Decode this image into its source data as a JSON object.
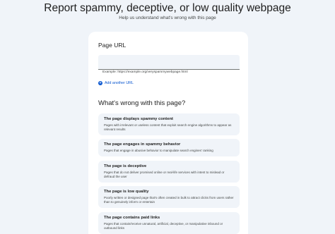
{
  "header": {
    "title": "Report spammy, deceptive, or low quality webpage",
    "subtitle": "Help us understand what's wrong with this page"
  },
  "url_section": {
    "label": "Page URL",
    "input_value": "",
    "helper": "Example: https://example.org/veryspammywebpage.html",
    "add_link": "Add another URL"
  },
  "question": {
    "heading": "What's wrong with this page?",
    "options": [
      {
        "title": "The page displays spammy content",
        "description": "Pages with irrelevant or useless content that exploit search engine algorithms to appear as relevant results"
      },
      {
        "title": "The page engages in spammy behavior",
        "description": "Pages that engage in abusive behavior to manipulate search engines' ranking"
      },
      {
        "title": "The page is deceptive",
        "description": "Pages that do not deliver promised online or real-life services with intent to mislead or defraud the user"
      },
      {
        "title": "The page is low quality",
        "description": "Poorly written or designed page that's often created in bulk to attract clicks from users rather than to genuinely inform or entertain"
      },
      {
        "title": "The page contains paid links",
        "description": "Pages that contain/receive unnatural, artificial, deceptive, or manipulative inbound or outbound links"
      }
    ]
  }
}
